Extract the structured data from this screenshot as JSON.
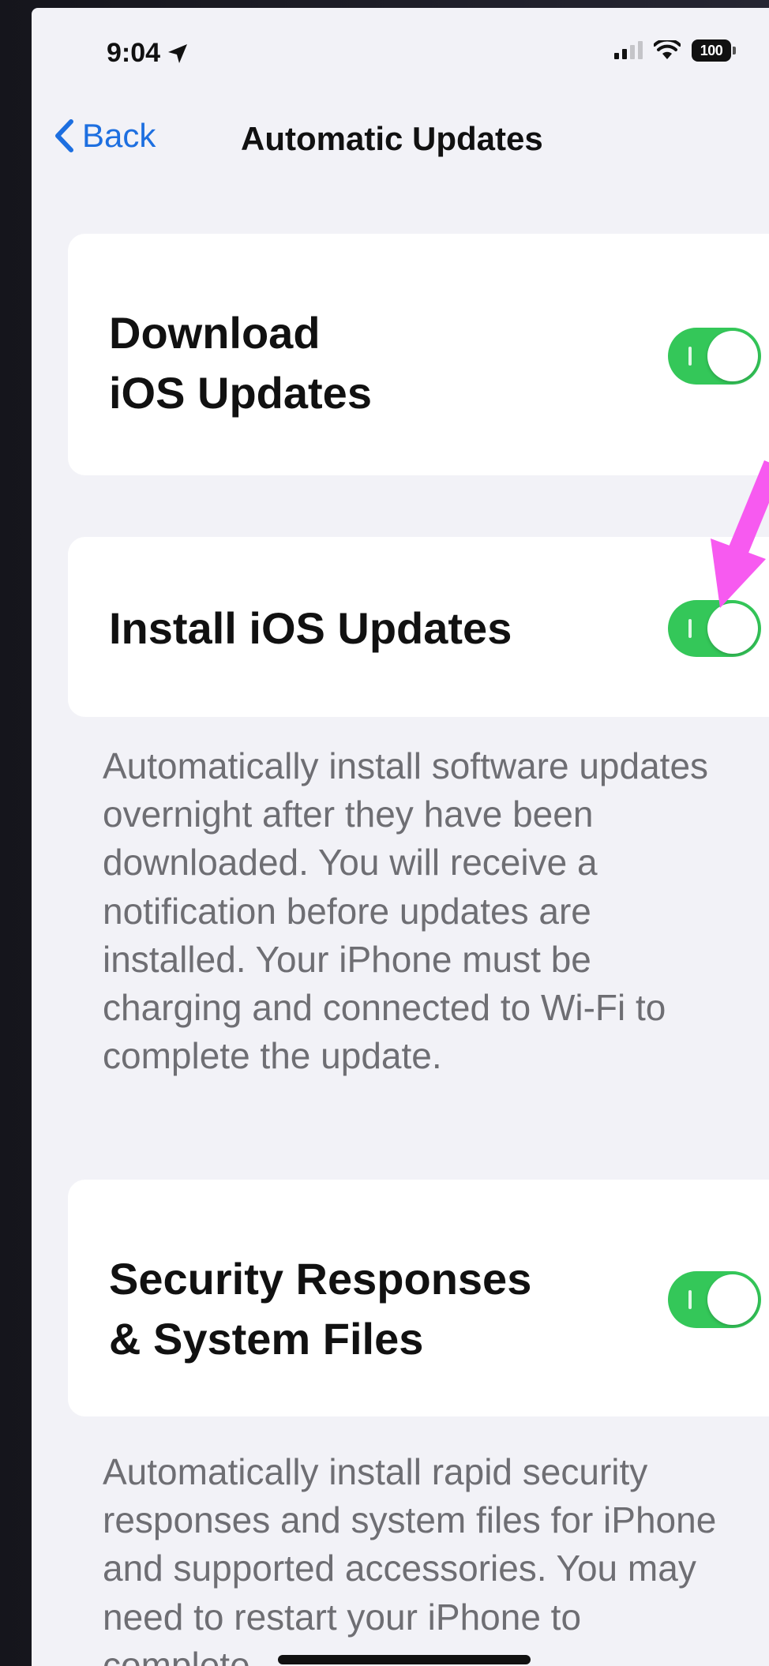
{
  "status_bar": {
    "time": "9:04",
    "battery": "100"
  },
  "nav": {
    "back_label": "Back",
    "title": "Automatic Updates"
  },
  "settings": [
    {
      "label_lines": [
        "Download",
        "iOS Updates"
      ],
      "enabled": true
    },
    {
      "label_lines": [
        "Install iOS Updates"
      ],
      "enabled": true,
      "footer": "Automatically install software updates overnight after they have been downloaded. You will receive a notification before updates are installed. Your iPhone must be charging and connected to Wi-Fi to complete the update."
    },
    {
      "label_lines": [
        "Security Responses",
        "& System Files"
      ],
      "enabled": true,
      "footer": "Automatically install rapid security responses and system files for iPhone and supported accessories. You may need to restart your iPhone to complete"
    }
  ],
  "colors": {
    "toggle_on": "#34c759",
    "accent": "#1d6fe0",
    "annotation_arrow": "#f75af0"
  }
}
